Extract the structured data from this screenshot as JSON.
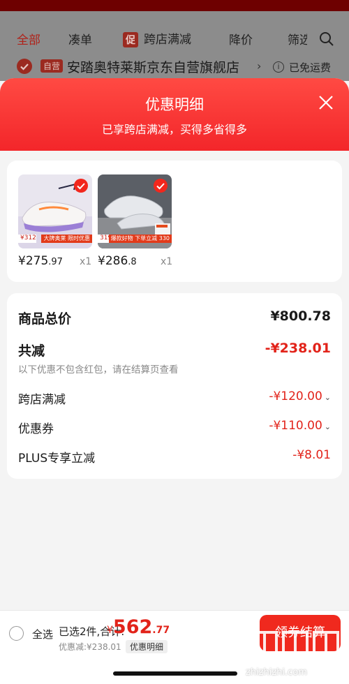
{
  "background_page": {
    "tabs": [
      {
        "label": "全部",
        "active": true
      },
      {
        "label": "凑单",
        "active": false
      },
      {
        "label": "跨店满减",
        "badge": "促",
        "active": false
      },
      {
        "label": "降价",
        "active": false
      },
      {
        "label": "筛选",
        "active": false
      }
    ],
    "store": {
      "badge": "自营",
      "name": "安踏奥特莱斯京东自营旗舰店",
      "chevron": "›",
      "shipping_icon": "i",
      "shipping": "已免运费"
    }
  },
  "sheet": {
    "title": "优惠明细",
    "subtitle": "已享跨店满减，买得多省得多",
    "products": [
      {
        "price_int": "¥275",
        "price_dec": ".97",
        "qty": "x1",
        "tag_price": "¥312",
        "promo": "大牌奥莱 限时优惠"
      },
      {
        "price_int": "¥286",
        "price_dec": ".8",
        "qty": "x1",
        "tag_price": "319",
        "promo": "爆款好物 下单立减 330"
      }
    ],
    "summary": {
      "total_label": "商品总价",
      "total_value": "¥800.78",
      "reduce_label": "共减",
      "reduce_value": "-¥238.01",
      "note": "以下优惠不包含红包，请在结算页查看",
      "lines": [
        {
          "label": "跨店满减",
          "value": "-¥120.00",
          "chevron": true
        },
        {
          "label": "优惠券",
          "value": "-¥110.00",
          "chevron": true
        },
        {
          "label": "PLUS专享立减",
          "value": "-¥8.01",
          "chevron": false
        }
      ]
    }
  },
  "bottom": {
    "select_all": "全选",
    "selected": "已选2件,合计:",
    "yen": "¥",
    "total_int": "562",
    "total_dec": ".77",
    "discount": "优惠减:¥238.01",
    "detail_chip": "优惠明细",
    "checkout": "领券结算",
    "watermark_text": "zhizhizhi.com"
  },
  "colors": {
    "accent": "#f0291e",
    "price_red": "#e2231a"
  }
}
